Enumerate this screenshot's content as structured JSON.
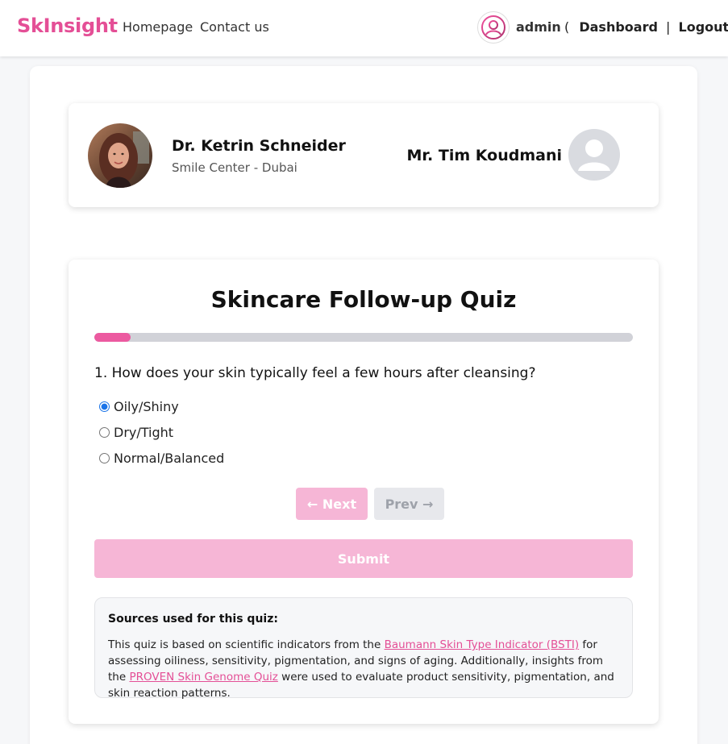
{
  "header": {
    "brand": "SkInsight",
    "nav": {
      "home": "Homepage",
      "contact": "Contact us"
    },
    "user": {
      "name": "admin",
      "open_paren": "(",
      "dashboard": "Dashboard",
      "separator": "|",
      "logout": "Logout",
      "close_paren": ")"
    }
  },
  "profile": {
    "doctor_name": "Dr. Ketrin Schneider",
    "doctor_clinic": "Smile Center - Dubai",
    "patient_name": "Mr. Tim Koudmani"
  },
  "quiz": {
    "title": "Skincare Follow-up Quiz",
    "progress_percent": 6.7,
    "question": "1. How does your skin typically feel a few hours after cleansing?",
    "options": [
      {
        "label": "Oily/Shiny",
        "selected": true
      },
      {
        "label": "Dry/Tight",
        "selected": false
      },
      {
        "label": "Normal/Balanced",
        "selected": false
      }
    ],
    "next_label": "← Next",
    "prev_label": "Prev →",
    "submit_label": "Submit"
  },
  "sources": {
    "title": "Sources used for this quiz:",
    "text_1": "This quiz is based on scientific indicators from the ",
    "link_1": "Baumann Skin Type Indicator (BSTI)",
    "text_2": " for assessing oiliness, sensitivity, pigmentation, and signs of aging. Additionally, insights from the ",
    "link_2": "PROVEN Skin Genome Quiz",
    "text_3": " were used to evaluate product sensitivity, pigmentation, and skin reaction patterns."
  },
  "colors": {
    "brand": "#e44f96",
    "progress_fill": "#ec5aa0",
    "button_disabled_pink": "#f6b6d6",
    "link": "#e44f96"
  },
  "icons": {
    "header_avatar": "user-circle-icon",
    "patient_avatar": "default-user-icon"
  }
}
